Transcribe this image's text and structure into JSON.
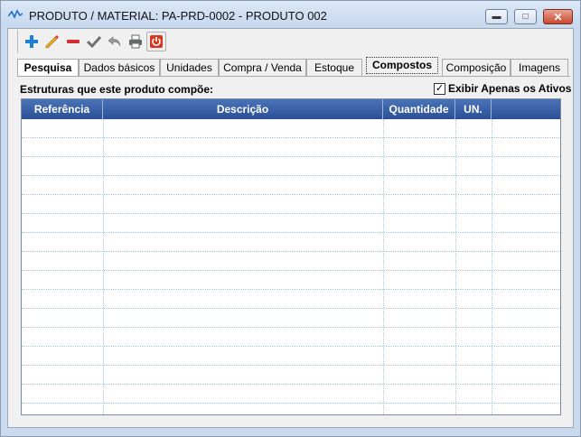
{
  "window": {
    "title": "PRODUTO / MATERIAL: PA-PRD-0002 - PRODUTO 002"
  },
  "toolbar": {
    "buttons": [
      {
        "name": "add-icon",
        "color": "#1e7fd6"
      },
      {
        "name": "edit-pencil-icon",
        "color": "#e0a020"
      },
      {
        "name": "remove-icon",
        "color": "#d23030"
      },
      {
        "name": "confirm-check-icon",
        "color": "#707070"
      },
      {
        "name": "undo-icon",
        "color": "#707070"
      },
      {
        "name": "print-icon",
        "color": "#2a8a3a"
      },
      {
        "name": "power-icon",
        "color": "#d8361e"
      }
    ]
  },
  "tabs": [
    {
      "label": "Pesquisa"
    },
    {
      "label": "Dados básicos"
    },
    {
      "label": "Unidades"
    },
    {
      "label": "Compra / Venda"
    },
    {
      "label": "Estoque"
    },
    {
      "label": "Compostos"
    },
    {
      "label": "Composição"
    },
    {
      "label": "Imagens"
    }
  ],
  "section": {
    "label": "Estruturas que este produto compõe:",
    "filter_label": "Exibir Apenas os Ativos",
    "filter_checked": true
  },
  "grid": {
    "columns": [
      "Referência",
      "Descrição",
      "Quantidade",
      "UN.",
      ""
    ],
    "rows": []
  },
  "colors": {
    "header_blue": "#2a4f96",
    "frame_blue": "#c9d9ee"
  }
}
